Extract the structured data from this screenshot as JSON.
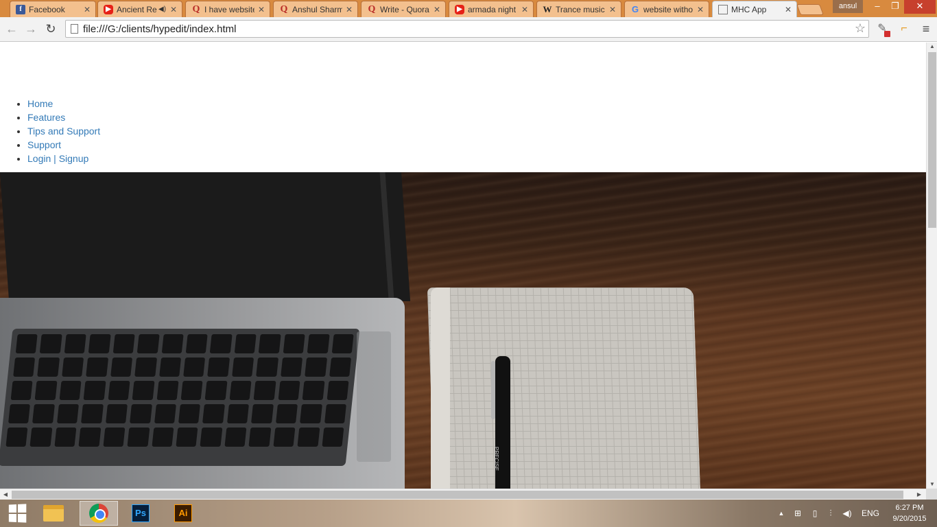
{
  "browser": {
    "tabs": [
      {
        "title": "Facebook",
        "favicon": "facebook-icon"
      },
      {
        "title": "Ancient Re",
        "favicon": "youtube-icon",
        "audio": true
      },
      {
        "title": "I have website",
        "favicon": "quora-icon"
      },
      {
        "title": "Anshul Sharm",
        "favicon": "quora-icon"
      },
      {
        "title": "Write - Quora",
        "favicon": "quora-icon"
      },
      {
        "title": "armada night",
        "favicon": "youtube-icon"
      },
      {
        "title": "Trance music",
        "favicon": "wikipedia-icon"
      },
      {
        "title": "website witho",
        "favicon": "google-icon"
      },
      {
        "title": "MHC App",
        "favicon": "page-icon",
        "active": true
      }
    ],
    "favicon_glyphs": {
      "facebook": "f",
      "youtube": "▶",
      "quora": "Q",
      "wikipedia": "W",
      "google": "G"
    },
    "profile_name": "ansul",
    "window_controls": {
      "minimize": "–",
      "maximize": "❐",
      "close": "✕"
    },
    "address_bar": {
      "url": "file:///G:/clients/hypedit/index.html"
    },
    "accent_colors": {
      "tabstrip": "#d88a3f",
      "link": "#337ab7"
    }
  },
  "page": {
    "nav": [
      {
        "label": "Home"
      },
      {
        "label": "Features"
      },
      {
        "label": "Tips and Support"
      },
      {
        "label": "Support"
      }
    ],
    "auth": {
      "login": "Login",
      "separator": "|",
      "signup": "Signup"
    },
    "hero": {
      "pen_brand": "PRECISE"
    }
  },
  "taskbar": {
    "apps": [
      {
        "name": "File Explorer"
      },
      {
        "name": "Google Chrome",
        "active": true
      },
      {
        "name": "Adobe Photoshop",
        "label": "Ps"
      },
      {
        "name": "Adobe Illustrator",
        "label": "Ai"
      }
    ],
    "language": "ENG",
    "time": "6:27 PM",
    "date": "9/20/2015"
  }
}
